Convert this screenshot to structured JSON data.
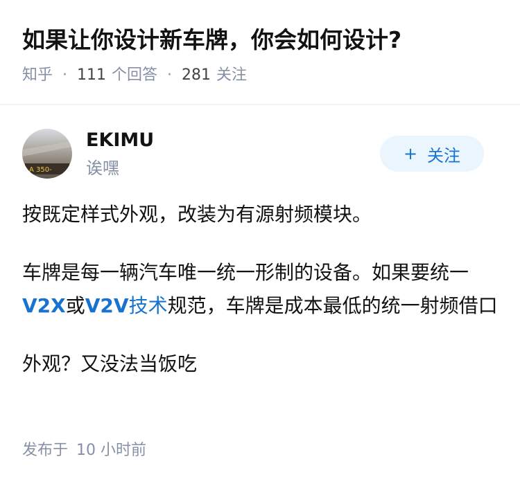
{
  "question": {
    "title": "如果让你设计新车牌，你会如何设计?",
    "source": "知乎",
    "answers_count": "111",
    "answers_label": "个回答",
    "followers_count": "281",
    "followers_label": "关注"
  },
  "author": {
    "name": "EKIMU",
    "bio": "诶嘿",
    "avatar_text": "A 350-",
    "follow_label": "关注",
    "follow_icon": "plus-icon"
  },
  "answer": {
    "p1": "按既定样式外观，改装为有源射频模块。",
    "p2_a": "车牌是每一辆汽车唯一统一形制的设备。如果要统一",
    "p2_link1": "V2X",
    "p2_b": "或",
    "p2_link2": "V2V",
    "p2_link3": "技术",
    "p2_c": "规范，车牌是成本最低的统一射频借口",
    "p3": "外观？又没法当饭吃"
  },
  "footer": {
    "published_label": "发布于",
    "published_time": "10 小时前"
  },
  "colors": {
    "link": "#1772d0",
    "meta": "#8590a6",
    "follow_bg": "#ebf5fd"
  }
}
